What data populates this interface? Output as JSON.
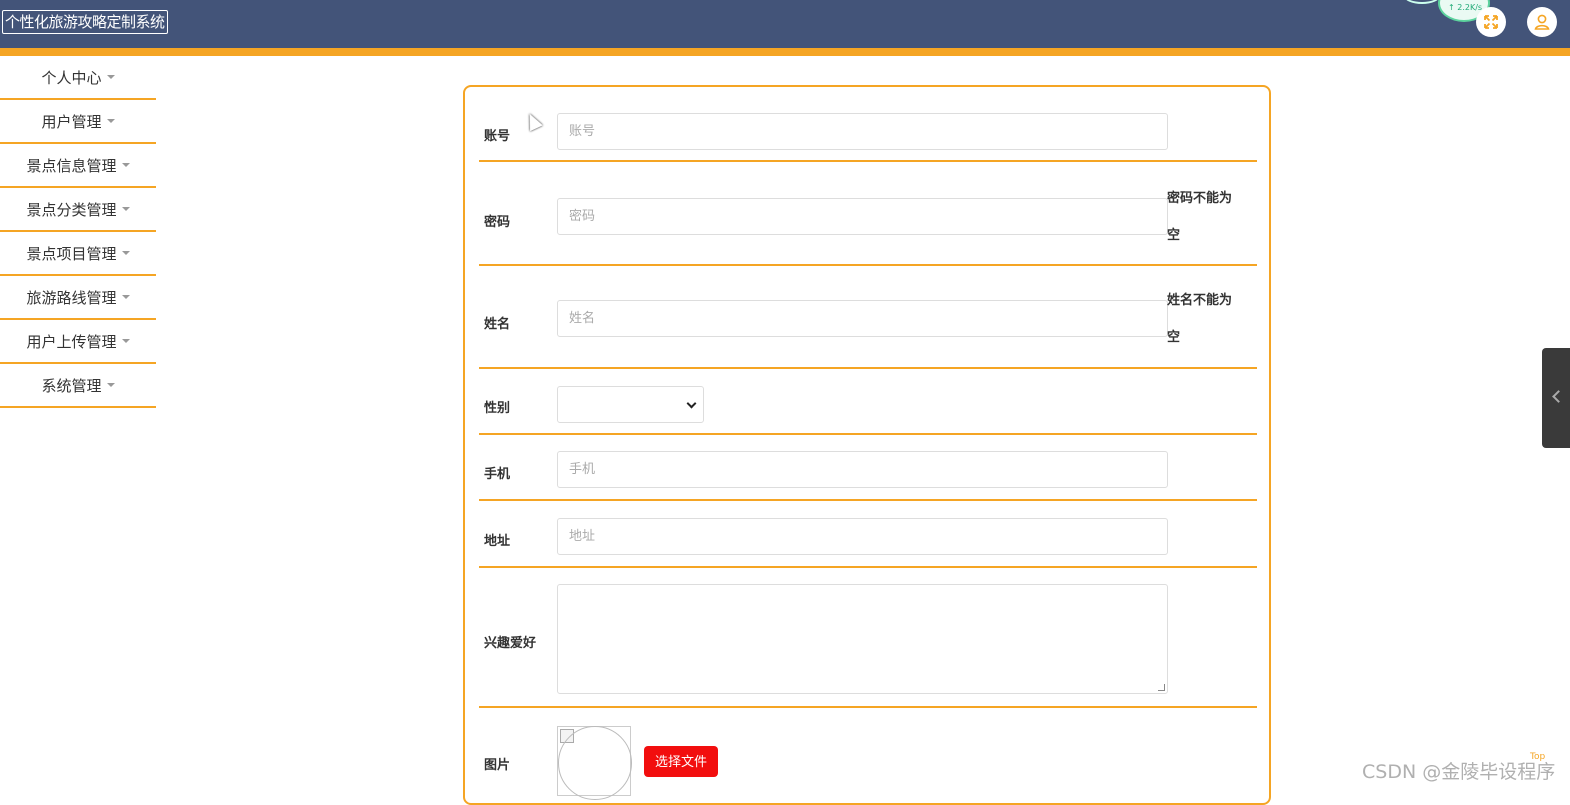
{
  "app": {
    "title": "个性化旅游攻略定制系统",
    "accent_color": "#f5a524",
    "header_color": "#435479"
  },
  "header": {
    "net_speed": "↑ 2.2K/s",
    "fullscreen_icon": "expand-icon",
    "user_icon": "user-icon"
  },
  "sidebar": {
    "items": [
      {
        "label": "个人中心"
      },
      {
        "label": "用户管理"
      },
      {
        "label": "景点信息管理"
      },
      {
        "label": "景点分类管理"
      },
      {
        "label": "景点项目管理"
      },
      {
        "label": "旅游路线管理"
      },
      {
        "label": "用户上传管理"
      },
      {
        "label": "系统管理"
      }
    ]
  },
  "form": {
    "account": {
      "label": "账号",
      "placeholder": "账号"
    },
    "password": {
      "label": "密码",
      "placeholder": "密码",
      "error": "密码不能为空"
    },
    "name": {
      "label": "姓名",
      "placeholder": "姓名",
      "error": "姓名不能为空"
    },
    "gender": {
      "label": "性别",
      "value": ""
    },
    "phone": {
      "label": "手机",
      "placeholder": "手机"
    },
    "address": {
      "label": "地址",
      "placeholder": "地址"
    },
    "hobbies": {
      "label": "兴趣爱好",
      "value": ""
    },
    "image": {
      "label": "图片",
      "button": "选择文件"
    }
  },
  "overlay": {
    "watermark": "CSDN @金陵毕设程序",
    "top_label": "Top"
  }
}
